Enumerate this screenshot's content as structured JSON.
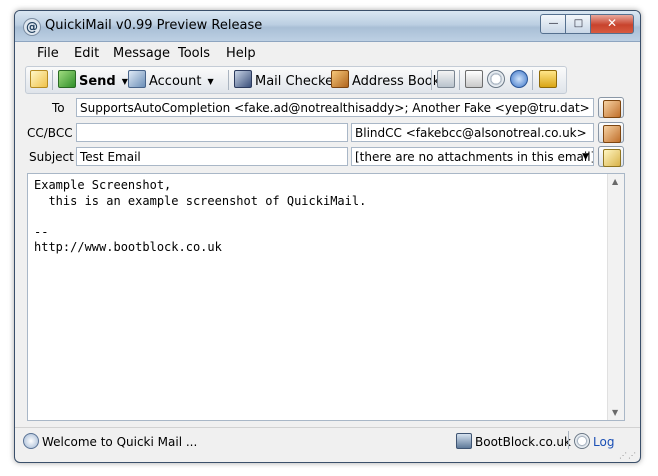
{
  "window": {
    "title": "QuickiMail v0.99 Preview Release",
    "minimize_glyph": "—",
    "maximize_glyph": "□",
    "close_glyph": "✕"
  },
  "menu": [
    "File",
    "Edit",
    "Message",
    "Tools",
    "Help"
  ],
  "toolbar": {
    "send_label": "Send",
    "account_label": "Account",
    "mail_checker_label": "Mail Checker",
    "address_book_label": "Address Book"
  },
  "fields": {
    "to_label": "To",
    "to_value": "SupportsAutoCompletion <fake.ad@notrealthisaddy>; Another Fake <yep@tru.dat>",
    "cc_label": "CC/BCC",
    "cc_value": "",
    "bcc_value": "BlindCC <fakebcc@alsonotreal.co.uk>",
    "subject_label": "Subject",
    "subject_value": "Test Email",
    "attachments_value": "[there are no attachments in this email]"
  },
  "body_text": "Example Screenshot,\n  this is an example screenshot of QuickiMail.\n\n--\nhttp://www.bootblock.co.uk",
  "status": {
    "message": "Welcome to Quicki Mail ...",
    "site": "BootBlock.co.uk",
    "log_label": "Log"
  },
  "colors": {
    "link": "#1a4fb5",
    "title_bar": "#bccfe2",
    "close_button": "#c8432d"
  }
}
